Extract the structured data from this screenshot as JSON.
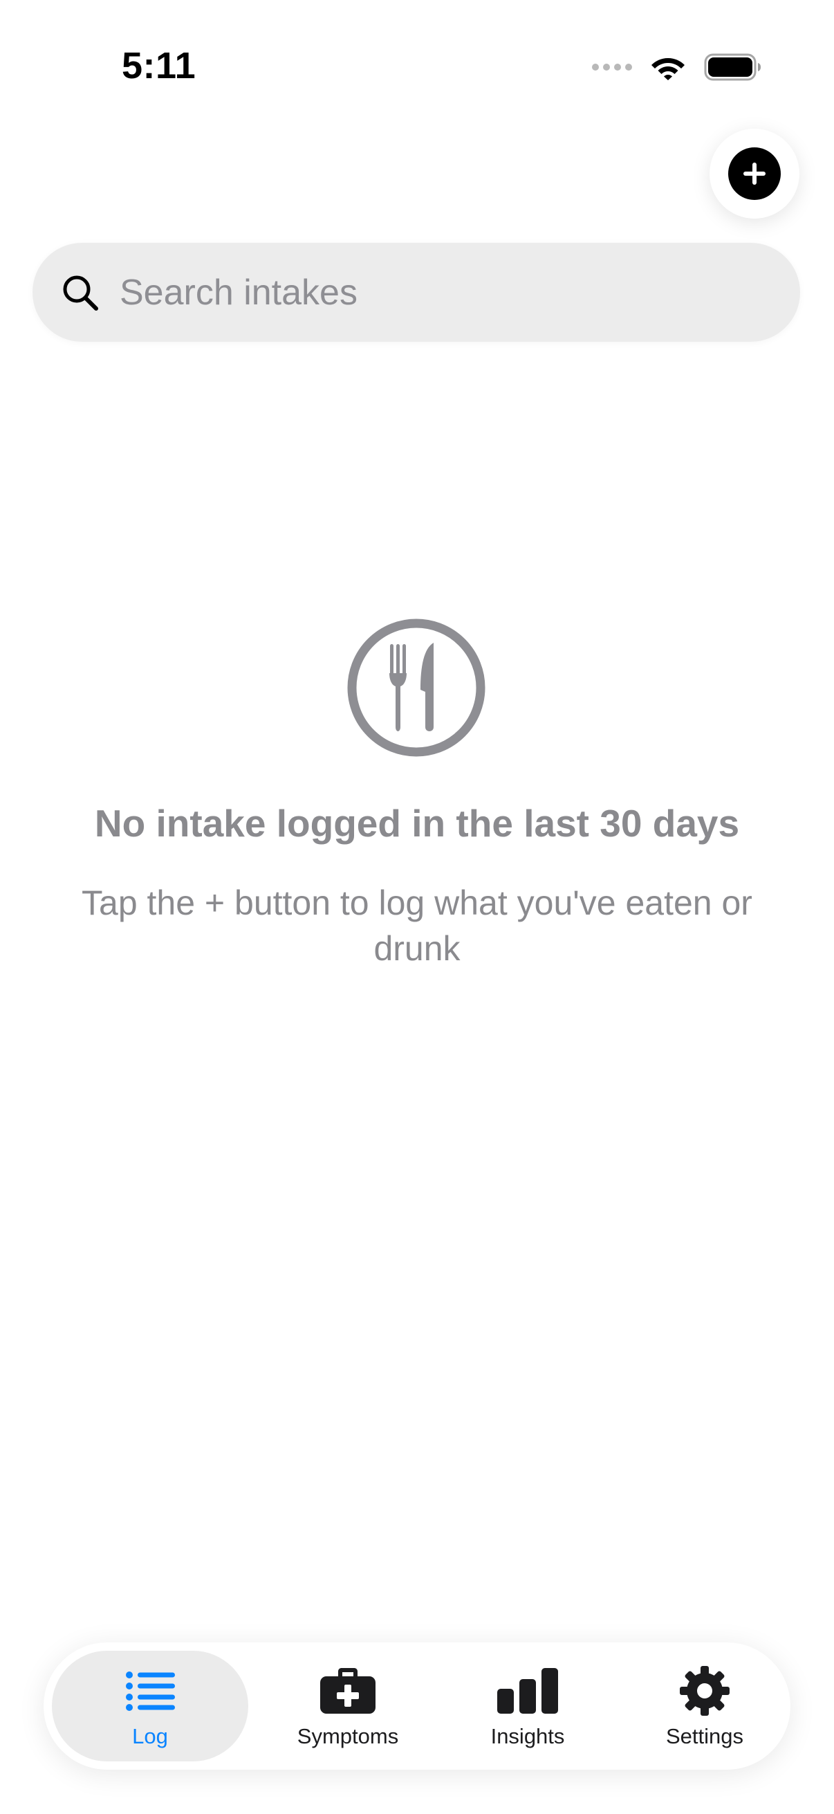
{
  "status_bar": {
    "time": "5:11"
  },
  "search": {
    "placeholder": "Search intakes",
    "value": ""
  },
  "empty_state": {
    "icon": "fork-knife-icon",
    "title": "No intake logged in the last 30 days",
    "subtitle": "Tap the + button to log what you've eaten or drunk"
  },
  "tabs": [
    {
      "label": "Log",
      "icon": "list-icon",
      "active": true
    },
    {
      "label": "Symptoms",
      "icon": "medical-kit-icon",
      "active": false
    },
    {
      "label": "Insights",
      "icon": "bar-chart-icon",
      "active": false
    },
    {
      "label": "Settings",
      "icon": "gear-icon",
      "active": false
    }
  ],
  "colors": {
    "accent": "#0a84ff",
    "muted_text": "#8a8a8e",
    "search_fill": "#ececec",
    "active_tab_fill": "#ebebeb"
  }
}
